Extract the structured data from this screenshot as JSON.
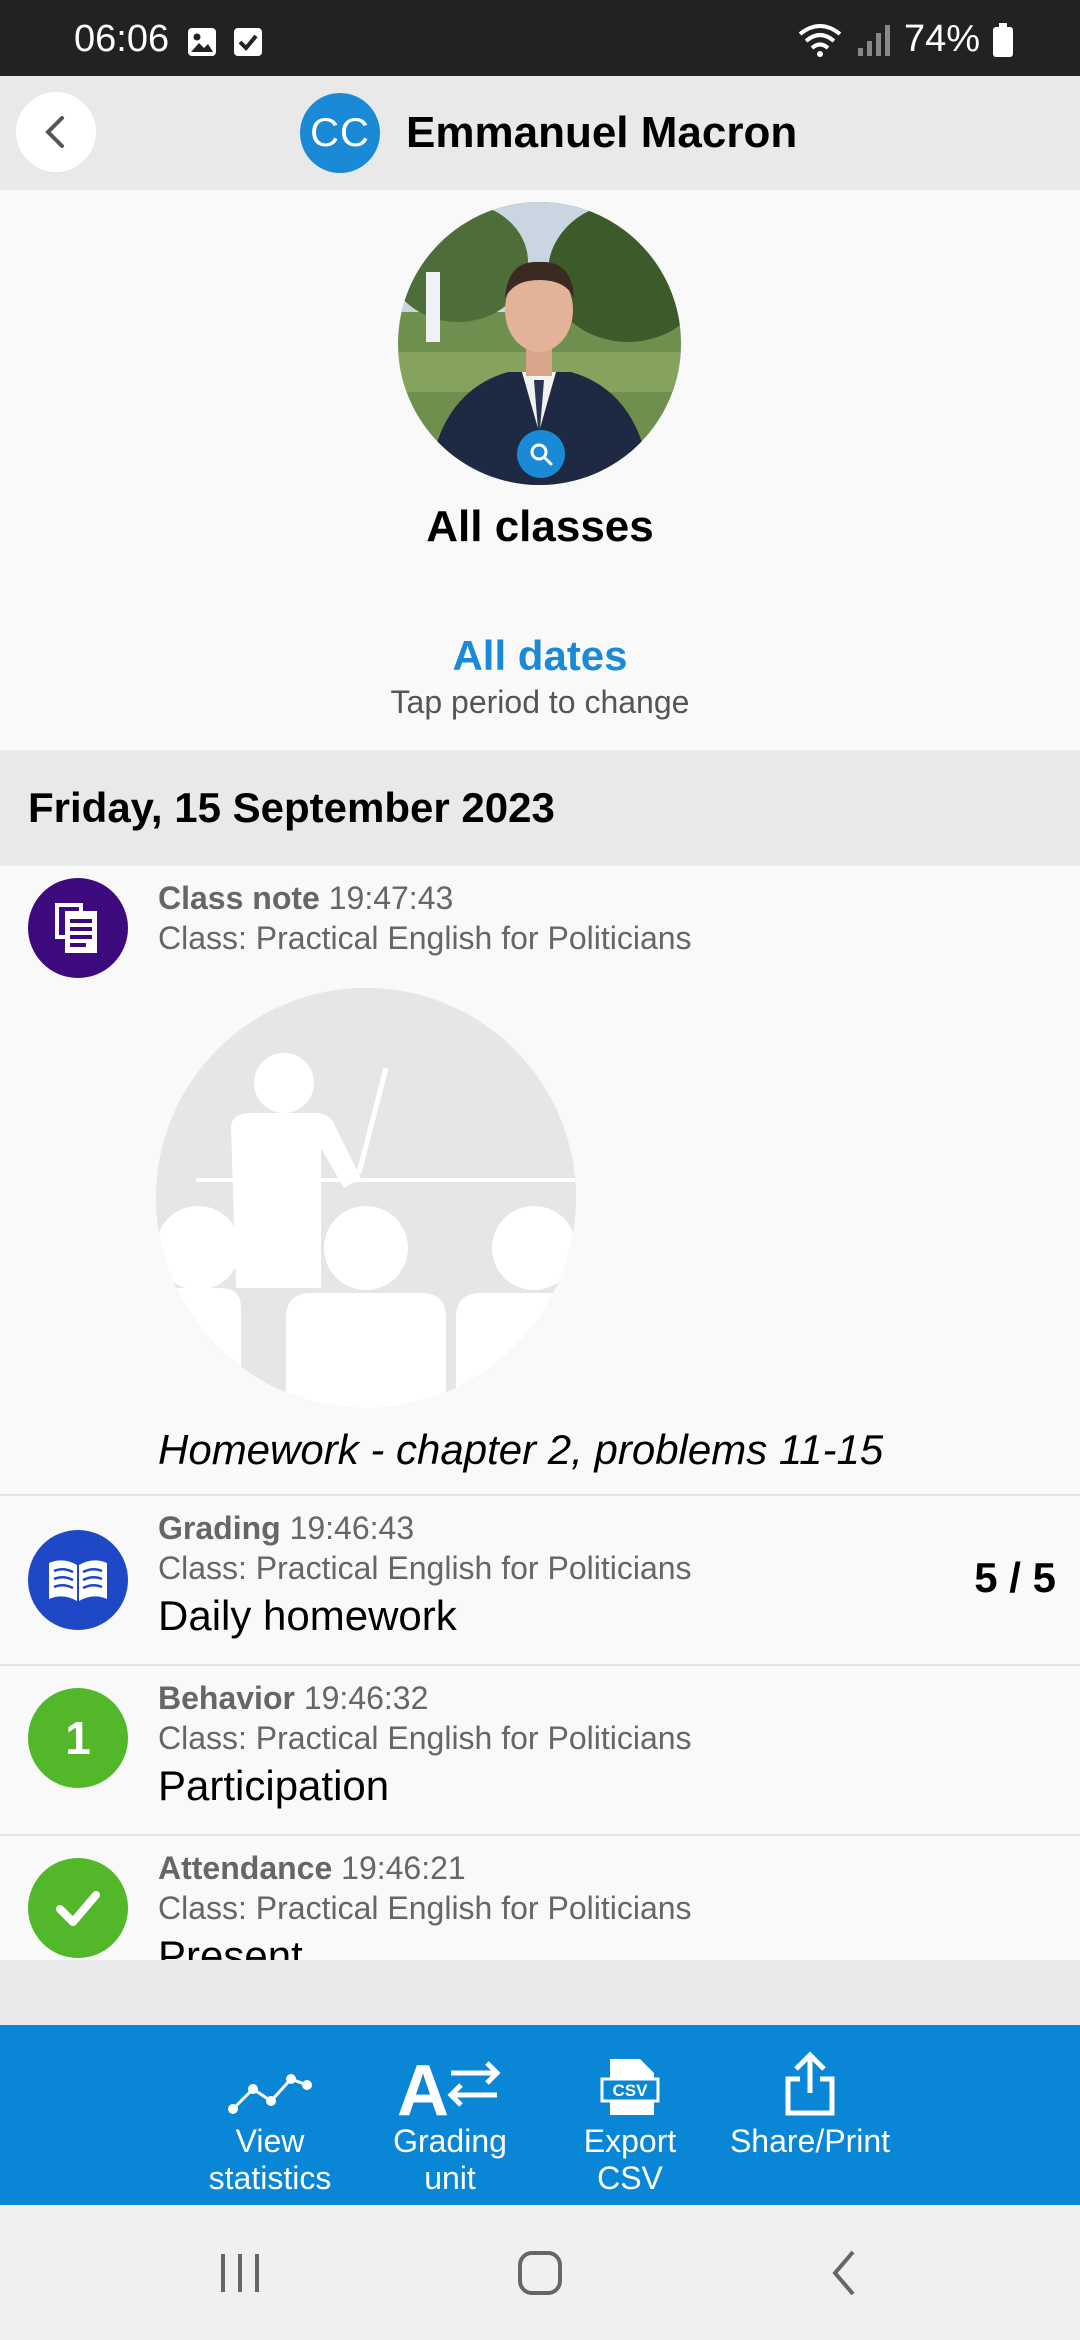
{
  "status_bar": {
    "time": "06:06",
    "battery": "74%"
  },
  "header": {
    "badge": "CC",
    "title": "Emmanuel Macron"
  },
  "profile": {
    "classes": "All classes",
    "dates": "All dates",
    "dates_hint": "Tap period to change"
  },
  "day": {
    "date": "Friday, 15 September 2023"
  },
  "entries": [
    {
      "type": "Class note",
      "time": "19:47:43",
      "class": "Class: Practical English for Politicians",
      "value": "Homework - chapter 2, problems 11-15",
      "icon": "class-note-icon",
      "color": "#3d0a7e"
    },
    {
      "type": "Grading",
      "time": "19:46:43",
      "class": "Class: Practical English for Politicians",
      "value": "Daily homework",
      "score": "5 / 5",
      "icon": "book-icon",
      "color": "#1f48c6"
    },
    {
      "type": "Behavior",
      "time": "19:46:32",
      "class": "Class: Practical English for Politicians",
      "value": "Participation",
      "badge": "1",
      "color": "#52b82a"
    },
    {
      "type": "Attendance",
      "time": "19:46:21",
      "class": "Class: Practical English for Politicians",
      "value": "Present",
      "icon": "check-icon",
      "color": "#52b82a"
    }
  ],
  "toolbar": {
    "stats_line1": "View",
    "stats_line2": "statistics",
    "grading_line1": "Grading",
    "grading_line2": "unit",
    "export_line1": "Export",
    "export_line2": "CSV",
    "export_icon_text": "CSV",
    "share": "Share/Print",
    "grading_icon_letter": "A"
  },
  "colors": {
    "accent": "#0a86d6",
    "header_bg": "#e9e9e9"
  }
}
